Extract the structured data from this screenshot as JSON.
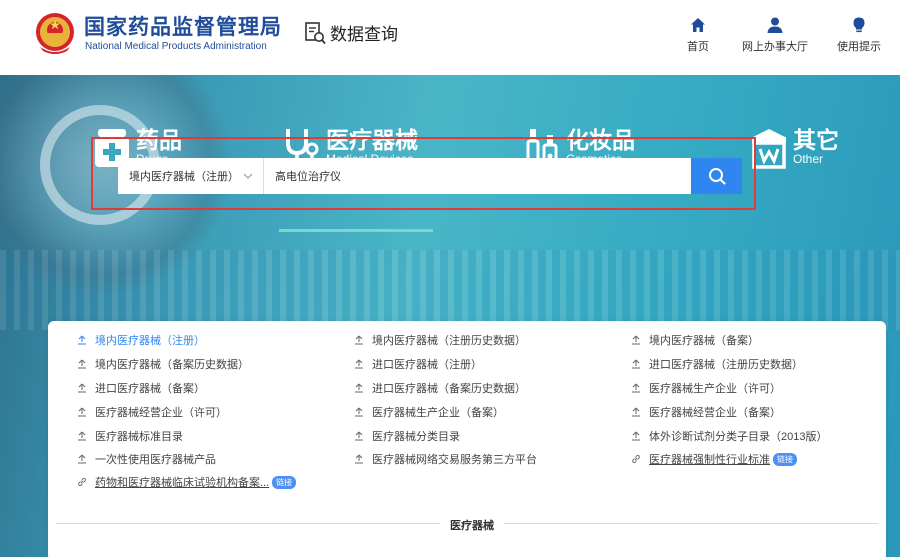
{
  "header": {
    "brand_cn": "国家药品监督管理局",
    "brand_en": "National Medical Products Administration",
    "query_label": "数据查询",
    "nav": [
      {
        "label": "首页",
        "icon": "home-icon"
      },
      {
        "label": "网上办事大厅",
        "icon": "user-icon"
      },
      {
        "label": "使用提示",
        "icon": "bulb-icon"
      }
    ],
    "brand_color": "#1f4d9c"
  },
  "categories": [
    {
      "cn": "药品",
      "en": "Drugs",
      "icon": "medicine-box-icon"
    },
    {
      "cn": "医疗器械",
      "en": "Medical Devices",
      "icon": "stethoscope-icon",
      "active": true
    },
    {
      "cn": "化妆品",
      "en": "Cosmetics",
      "icon": "cosmetics-icon"
    },
    {
      "cn": "其它",
      "en": "Other",
      "icon": "store-icon"
    }
  ],
  "search": {
    "select_value": "境内医疗器械（注册）",
    "query_value": "高电位治疗仪",
    "button_icon": "search-icon",
    "accent": "#2f86f0",
    "highlight_frame": "#e03a3a"
  },
  "links": [
    {
      "label": "境内医疗器械（注册）",
      "active": true
    },
    {
      "label": "境内医疗器械（注册历史数据）"
    },
    {
      "label": "境内医疗器械（备案）"
    },
    {
      "label": "境内医疗器械（备案历史数据）"
    },
    {
      "label": "进口医疗器械（注册）"
    },
    {
      "label": "进口医疗器械（注册历史数据）"
    },
    {
      "label": "进口医疗器械（备案）"
    },
    {
      "label": "进口医疗器械（备案历史数据）"
    },
    {
      "label": "医疗器械生产企业（许可）"
    },
    {
      "label": "医疗器械经营企业（许可）"
    },
    {
      "label": "医疗器械生产企业（备案）"
    },
    {
      "label": "医疗器械经营企业（备案）"
    },
    {
      "label": "医疗器械标准目录"
    },
    {
      "label": "医疗器械分类目录"
    },
    {
      "label": "体外诊断试剂分类子目录（2013版）"
    },
    {
      "label": "一次性使用医疗器械产品"
    },
    {
      "label": "医疗器械网络交易服务第三方平台"
    },
    {
      "label": "医疗器械强制性行业标准",
      "tag": "链接"
    },
    {
      "label": "药物和医疗器械临床试验机构备案...",
      "tag": "链接"
    }
  ],
  "panel_caption": "医疗器械"
}
